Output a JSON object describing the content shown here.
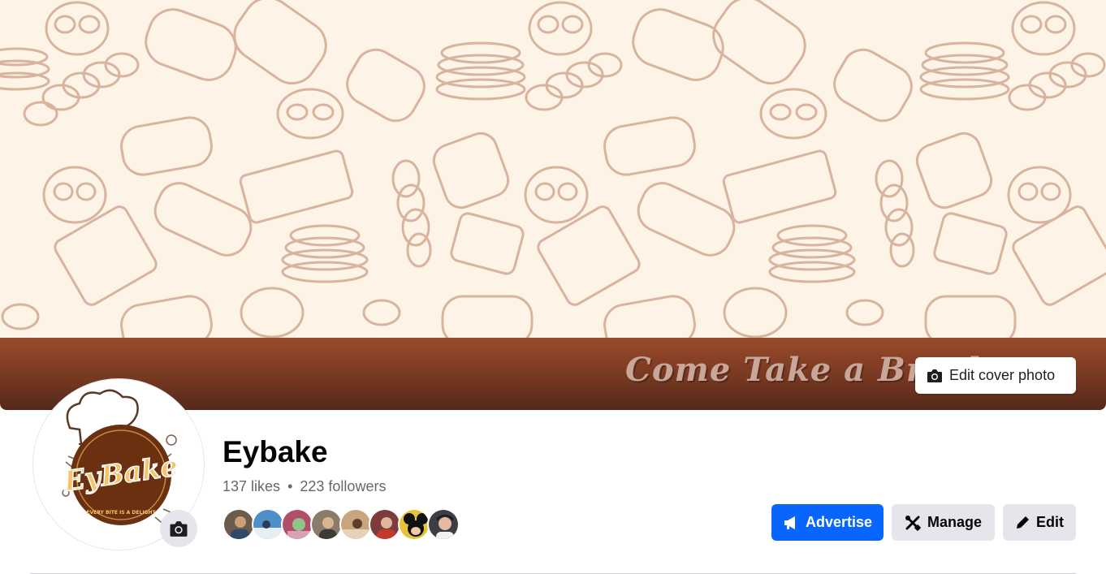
{
  "cover": {
    "tagline": "Come Take a Break",
    "edit_label": "Edit cover photo",
    "icon": "camera-icon",
    "background": "#fdf3e7",
    "line_color": "#d8b49e",
    "band_color": "#7a3a22"
  },
  "profile": {
    "name": "Eybake",
    "likes": "137 likes",
    "separator": "•",
    "followers": "223 followers",
    "logo_text": "EyBake",
    "logo_slogan": "EVERY BITE IS A DELIGHT",
    "avatar_camera_icon": "camera-icon"
  },
  "friends": [
    {
      "name": "friend-1",
      "color": "#6b5b4b"
    },
    {
      "name": "friend-2",
      "color": "#4e8fc7"
    },
    {
      "name": "friend-3",
      "color": "#b04f6a"
    },
    {
      "name": "friend-4",
      "color": "#8a7b6b"
    },
    {
      "name": "friend-5",
      "color": "#c9a57e"
    },
    {
      "name": "friend-6",
      "color": "#7d3b3b"
    },
    {
      "name": "friend-7",
      "color": "#e8c33a"
    },
    {
      "name": "friend-8",
      "color": "#3d3d44"
    }
  ],
  "actions": {
    "advertise": {
      "label": "Advertise",
      "icon": "megaphone-icon",
      "color": "#0866ff"
    },
    "manage": {
      "label": "Manage",
      "icon": "tools-icon"
    },
    "edit": {
      "label": "Edit",
      "icon": "pencil-icon"
    }
  }
}
